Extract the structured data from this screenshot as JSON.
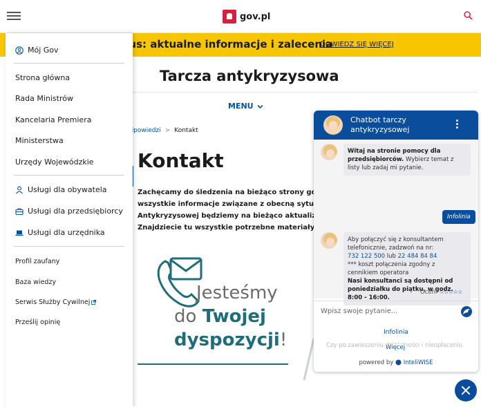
{
  "header": {
    "logo_text": "gov.pl"
  },
  "banner": {
    "text": "wirus: aktualne informacje i zalecenia",
    "link": "DOWIEDZ SIĘ WIĘCEJ"
  },
  "main": {
    "site_title": "Tarcza antykryzysowa",
    "menu_label": "MENU",
    "breadcrumb": {
      "parent": "nia i odpowiedzi",
      "separator": ">",
      "current": "Kontakt"
    },
    "page_title": "Kontakt",
    "intro_lines": [
      "Zachęcamy do śledzenia na bieżąco strony gov",
      "wszystkie informacje związane z obecną sytua",
      "Antykryzysowej będziemy na bieżąco aktualizo",
      "Znajdziecie tu wszystkie potrzebne materiały."
    ],
    "illustration": {
      "line1": "Jesteśmy",
      "line2_prefix": "do ",
      "line2_bold": "Twojej",
      "line3_bold": "dyspozycji",
      "line3_suffix": "!"
    }
  },
  "sidebar": {
    "account": "Mój Gov",
    "primary": [
      "Strona główna",
      "Rada Ministrów",
      "Kancelaria Premiera",
      "Ministerstwa",
      "Urzędy Wojewódzkie"
    ],
    "services": [
      "Usługi dla obywatela",
      "Usługi dla przedsiębiorcy",
      "Usługi dla urzędnika"
    ],
    "secondary": [
      "Profil zaufany",
      "Baza wiedzy",
      "Serwis Służby Cywilnej",
      "Prześlij opinię"
    ]
  },
  "chatbot": {
    "title": "Chatbot tarczy antykryzysowej",
    "welcome_bold": "Witaj na stronie pomocy dla przedsiębiorców.",
    "welcome_rest": "Wybierz temat z listy lub zadaj mi pytanie.",
    "user_message": "Infolinia",
    "reply_intro": "Aby połączyć się z konsultantem telefonicznie, zadzwoń na nr:",
    "phone1": "732 122 500",
    "phone_joiner": "lub",
    "phone2": "22 484 84 84",
    "reply_note": "*** koszt połączenia zgodny z cennikiem operatora",
    "reply_bold": "Nasi konsultanci są dostępni od poniedziałku do piątku, w godz. 8:00 - 16:00.",
    "rate_label": "Oceń:",
    "rate_stars": "☆☆☆☆☆",
    "input_placeholder": "Wpisz swoje pytanie...",
    "suggestion1": "Infolinia",
    "suggestion2": "Czy po zawieszeniu działalności i nieopłaceniu",
    "more": "Więcej",
    "powered_prefix": "powered by",
    "powered_brand": "InteliWISE"
  },
  "colors": {
    "accent": "#0052a5",
    "banner": "#f7c600",
    "chat_header": "#0a4d9c",
    "illustration_teal": "#1d6d7a"
  }
}
